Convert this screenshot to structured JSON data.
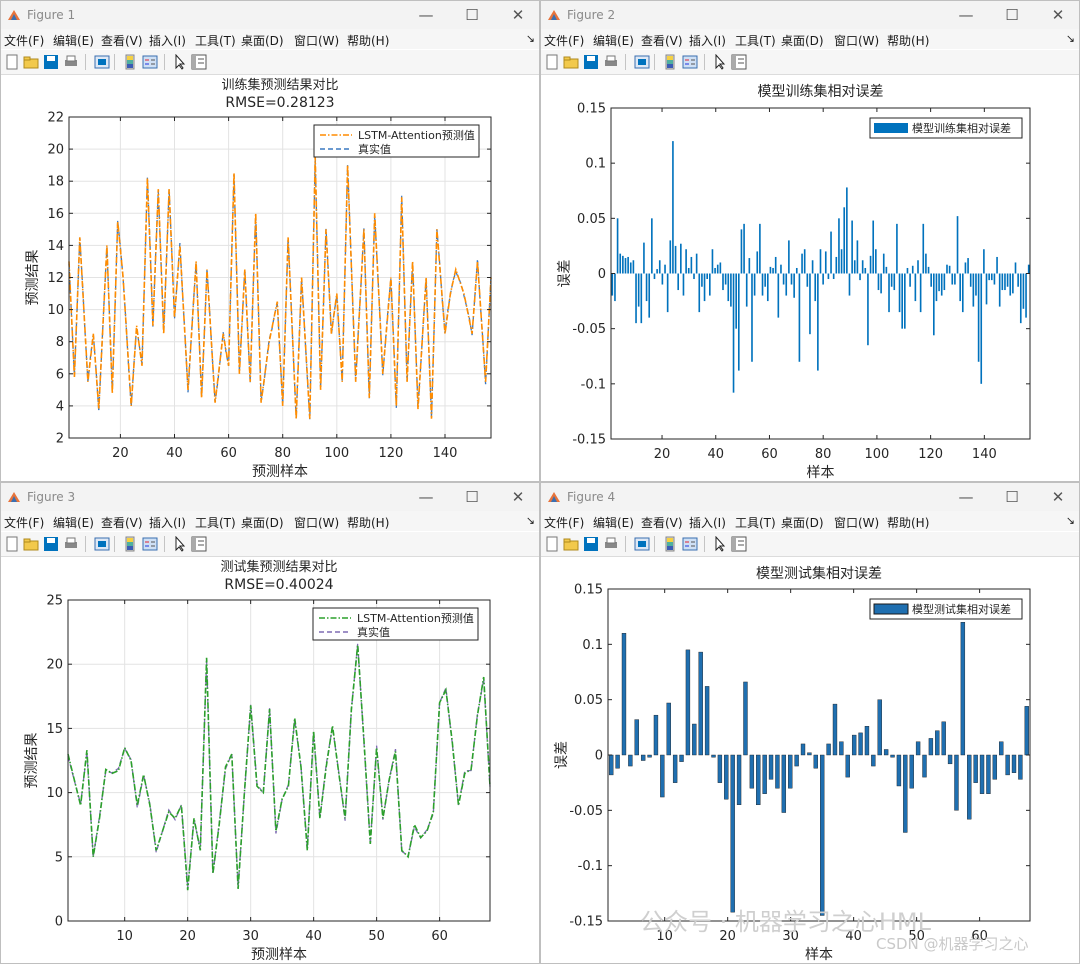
{
  "menu": [
    "文件(F)",
    "编辑(E)",
    "查看(V)",
    "插入(I)",
    "工具(T)",
    "桌面(D)",
    "窗口(W)",
    "帮助(H)"
  ],
  "window_controls": {
    "minimize": "—",
    "maximize": "☐",
    "close": "✕"
  },
  "icon_color": "#0072bd",
  "figures": [
    {
      "title": "Figure 1"
    },
    {
      "title": "Figure 2"
    },
    {
      "title": "Figure 3"
    },
    {
      "title": "Figure 4"
    }
  ],
  "watermark": {
    "line1": "公众号 · 机器学习之心HML",
    "line2": "CSDN @机器学习之心"
  },
  "chart_data": [
    {
      "type": "line",
      "title": "训练集预测结果对比",
      "subtitle": "RMSE=0.28123",
      "xlabel": "预测样本",
      "ylabel": "预测结果",
      "xlim": [
        1,
        157
      ],
      "ylim": [
        2,
        22
      ],
      "xticks": [
        20,
        40,
        60,
        80,
        100,
        120,
        140
      ],
      "yticks": [
        2,
        4,
        6,
        8,
        10,
        12,
        14,
        16,
        18,
        20,
        22
      ],
      "grid": true,
      "legend_position": "top-right",
      "series": [
        {
          "name": "LSTM-Attention预测值",
          "color": "#ff8c00",
          "style": "dashdot"
        },
        {
          "name": "真实值",
          "color": "#3a78c0",
          "style": "dashed"
        }
      ],
      "anchors_x": [
        1,
        3,
        5,
        8,
        10,
        12,
        15,
        17,
        19,
        21,
        24,
        26,
        28,
        30,
        32,
        34,
        36,
        38,
        40,
        42,
        45,
        48,
        50,
        52,
        55,
        58,
        60,
        62,
        64,
        66,
        68,
        70,
        72,
        75,
        78,
        80,
        82,
        85,
        87,
        90,
        92,
        94,
        96,
        98,
        100,
        102,
        104,
        107,
        110,
        112,
        114,
        117,
        120,
        122,
        124,
        126,
        128,
        130,
        133,
        135,
        137,
        140,
        142,
        144,
        147,
        150,
        152,
        155,
        157
      ],
      "anchors_y": [
        13,
        5.8,
        14.5,
        5.5,
        8.5,
        3.8,
        14,
        4.8,
        15.5,
        12,
        4,
        9,
        6.5,
        18.2,
        9,
        17.5,
        8.5,
        17.5,
        9.5,
        14,
        5,
        13,
        4.5,
        12.5,
        4.2,
        8.5,
        6.5,
        18.5,
        6,
        12.5,
        5.5,
        16,
        4.2,
        8,
        10.5,
        4,
        14.5,
        3.2,
        12,
        3.2,
        19.5,
        5,
        15,
        8.5,
        11,
        5.5,
        19,
        5.5,
        15,
        4.5,
        16,
        6,
        12,
        4,
        17,
        5.5,
        13,
        3.8,
        12,
        3.2,
        15,
        8.5,
        11,
        12.5,
        11,
        8.5,
        13,
        5.5,
        12
      ]
    },
    {
      "type": "bar",
      "title": "模型训练集相对误差",
      "xlabel": "样本",
      "ylabel": "误差",
      "xlim": [
        1,
        157
      ],
      "ylim": [
        -0.15,
        0.15
      ],
      "xticks": [
        20,
        40,
        60,
        80,
        100,
        120,
        140
      ],
      "yticks": [
        0.15,
        0.1,
        0.05,
        0,
        -0.05,
        -0.1,
        -0.15
      ],
      "legend_position": "top-right",
      "series": [
        {
          "name": "模型训练集相对误差",
          "color": "#0072bd"
        }
      ],
      "values": [
        -0.02,
        -0.025,
        0.05,
        0.018,
        0.016,
        0.014,
        0.015,
        0.01,
        0.012,
        -0.045,
        -0.03,
        -0.045,
        0.028,
        -0.025,
        -0.04,
        0.05,
        -0.005,
        0.004,
        0.012,
        -0.01,
        0.008,
        -0.035,
        0.03,
        0.12,
        0.025,
        -0.015,
        0.027,
        -0.02,
        0.022,
        0.005,
        0.015,
        -0.005,
        0.018,
        -0.035,
        -0.012,
        -0.025,
        -0.005,
        -0.02,
        0.022,
        0.005,
        0.008,
        0.01,
        -0.015,
        -0.01,
        -0.025,
        -0.03,
        -0.108,
        -0.05,
        -0.088,
        0.04,
        0.045,
        -0.03,
        0.014,
        -0.08,
        -0.02,
        0.02,
        0.045,
        -0.02,
        -0.012,
        -0.025,
        0.006,
        0.005,
        0.015,
        -0.04,
        0.008,
        -0.01,
        -0.02,
        0.03,
        -0.01,
        -0.022,
        0.005,
        -0.08,
        0.018,
        0.022,
        -0.012,
        -0.055,
        0.012,
        -0.025,
        -0.088,
        0.022,
        -0.01,
        0.02,
        -0.005,
        0.038,
        -0.005,
        0.015,
        0.05,
        0.022,
        0.06,
        0.078,
        -0.02,
        0.048,
        0.012,
        0.03,
        -0.006,
        0.012,
        0.005,
        -0.065,
        0.016,
        0.048,
        0.022,
        -0.015,
        -0.018,
        0.018,
        0.006,
        -0.035,
        -0.012,
        -0.015,
        0.045,
        -0.035,
        -0.05,
        -0.05,
        0.005,
        -0.012,
        0.007,
        -0.025,
        0.012,
        -0.035,
        0.045,
        0.018,
        0.006,
        -0.012,
        -0.056,
        -0.025,
        -0.016,
        -0.02,
        -0.015,
        0.008,
        0.007,
        -0.01,
        -0.01,
        0.052,
        -0.025,
        -0.035,
        0.01,
        0.014,
        -0.012,
        -0.03,
        -0.02,
        -0.08,
        -0.1,
        0.022,
        -0.028,
        -0.006,
        -0.006,
        -0.01,
        0.015,
        -0.03,
        -0.015,
        -0.015,
        -0.012,
        -0.02,
        -0.018,
        0.01,
        -0.012,
        -0.045,
        -0.032,
        -0.04,
        0.008
      ]
    },
    {
      "type": "line",
      "title": "测试集预测结果对比",
      "subtitle": "RMSE=0.40024",
      "xlabel": "预测样本",
      "ylabel": "预测结果",
      "xlim": [
        1,
        68
      ],
      "ylim": [
        0,
        25
      ],
      "xticks": [
        10,
        20,
        30,
        40,
        50,
        60
      ],
      "yticks": [
        0,
        5,
        10,
        15,
        20,
        25
      ],
      "grid": true,
      "legend_position": "top-right",
      "series": [
        {
          "name": "LSTM-Attention预测值",
          "color": "#2ca02c",
          "style": "dashdot"
        },
        {
          "name": "真实值",
          "color": "#7e6bb3",
          "style": "dashed"
        }
      ],
      "values": [
        13,
        11,
        9,
        13.3,
        5,
        8,
        11.8,
        11.5,
        11.7,
        13.5,
        12.5,
        9,
        11.4,
        9,
        5.5,
        7,
        8.5,
        8,
        9,
        2.4,
        8,
        5.5,
        20.5,
        3.7,
        7.5,
        12,
        13,
        2.5,
        10,
        16.8,
        10.5,
        10,
        16.5,
        7,
        9.5,
        10.5,
        15.8,
        12,
        5.5,
        14.8,
        8,
        12,
        15.2,
        11.5,
        8,
        16.5,
        21.5,
        14,
        6,
        13.5,
        8,
        11,
        13.2,
        5.5,
        5,
        7.5,
        6.5,
        7,
        8.5,
        17,
        18,
        14,
        9,
        11.5,
        11.8,
        16,
        19,
        10.5
      ]
    },
    {
      "type": "bar",
      "title": "模型测试集相对误差",
      "xlabel": "样本",
      "ylabel": "误差",
      "xlim": [
        1,
        68
      ],
      "ylim": [
        -0.15,
        0.15
      ],
      "xticks": [
        10,
        20,
        30,
        40,
        50,
        60
      ],
      "yticks": [
        0.15,
        0.1,
        0.05,
        0,
        -0.05,
        -0.1,
        -0.15
      ],
      "legend_position": "top-right",
      "series": [
        {
          "name": "模型测试集相对误差",
          "color": "#1f6fb0"
        }
      ],
      "values": [
        -0.018,
        -0.012,
        0.11,
        -0.01,
        0.032,
        -0.005,
        -0.002,
        0.036,
        -0.038,
        0.047,
        -0.025,
        -0.006,
        0.095,
        0.028,
        0.093,
        0.062,
        -0.002,
        -0.025,
        -0.04,
        -0.142,
        -0.045,
        0.066,
        -0.03,
        -0.045,
        -0.035,
        -0.022,
        -0.03,
        -0.052,
        -0.03,
        -0.01,
        0.01,
        0.002,
        -0.012,
        -0.145,
        0.01,
        0.046,
        0.012,
        -0.02,
        0.018,
        0.02,
        0.026,
        -0.01,
        0.05,
        0.005,
        -0.002,
        -0.028,
        -0.07,
        -0.03,
        0.012,
        -0.02,
        0.015,
        0.022,
        0.03,
        -0.008,
        -0.05,
        0.12,
        -0.058,
        -0.025,
        -0.035,
        -0.035,
        -0.022,
        0.012,
        -0.018,
        -0.016,
        -0.022,
        0.044
      ]
    }
  ]
}
